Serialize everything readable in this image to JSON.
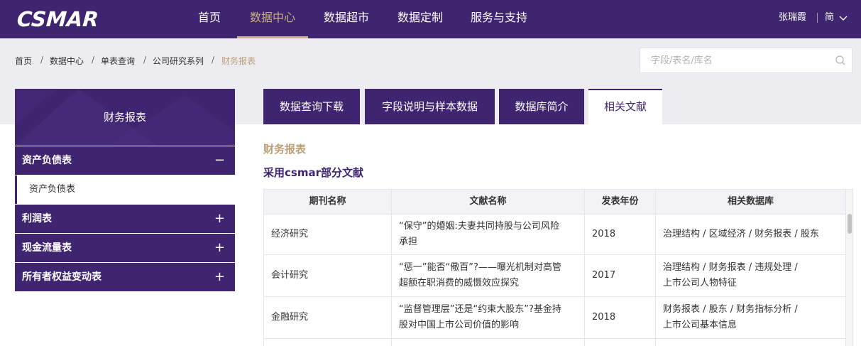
{
  "header": {
    "logo": "CSMAR",
    "nav": [
      "首页",
      "数据中心",
      "数据超市",
      "数据定制",
      "服务与支持"
    ],
    "active_nav": "数据中心",
    "user": "张瑞霞",
    "lang": "简"
  },
  "breadcrumb": [
    "首页",
    "数据中心",
    "单表查询",
    "公司研究系列",
    "财务报表"
  ],
  "search": {
    "placeholder": "字段/表名/库名",
    "value": ""
  },
  "sidebar": {
    "title": "财务报表",
    "items": [
      {
        "label": "资产负债表",
        "toggle": "−",
        "expanded": true
      },
      {
        "label": "利润表",
        "toggle": "+"
      },
      {
        "label": "现金流量表",
        "toggle": "+"
      },
      {
        "label": "所有者权益变动表",
        "toggle": "+"
      }
    ],
    "sub_item": "资产负债表"
  },
  "tabs": [
    "数据查询下载",
    "字段说明与样本数据",
    "数据库简介",
    "相关文献"
  ],
  "active_tab": "相关文献",
  "section": {
    "title": "财务报表",
    "subtitle": "采用csmar部分文献"
  },
  "table": {
    "headers": [
      "期刊名称",
      "文献名称",
      "发表年份",
      "相关数据库"
    ],
    "rows": [
      {
        "journal": "经济研究",
        "title_l1": "“保守”的婚姻:夫妻共同持股与公司风险",
        "title_l2": "承担",
        "year": "2018",
        "db_l1": "治理结构 / 区域经济 / 财务报表 / 股东",
        "db_l2": ""
      },
      {
        "journal": "会计研究",
        "title_l1": "“惩一”能否“儆百”?——曝光机制对高管",
        "title_l2": "超额在职消费的威慑效应探究",
        "year": "2017",
        "db_l1": "治理结构 / 财务报表 / 违规处理 /",
        "db_l2": "上市公司人物特征"
      },
      {
        "journal": "金融研究",
        "title_l1": "“监督管理层”还是“约束大股东”?基金持",
        "title_l2": "股对中国上市公司价值的影响",
        "year": "2018",
        "db_l1": "财务报表 / 股东 / 财务指标分析 /",
        "db_l2": "上市公司基本信息"
      }
    ]
  }
}
